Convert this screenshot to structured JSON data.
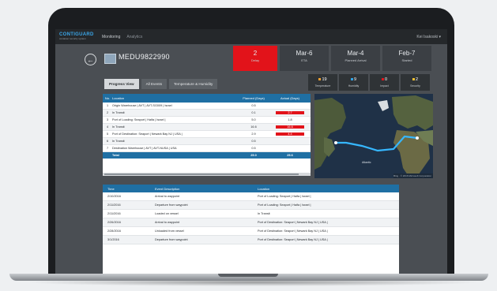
{
  "topbar": {
    "logo": "CONTIGUARD",
    "logo_sub": "container security system",
    "nav": [
      "Monitoring",
      "Analytics"
    ],
    "user": "Kei Isakoski ▾"
  },
  "header": {
    "container_id": "MEDU9822990",
    "stats": [
      {
        "big": "2",
        "small": "Delay",
        "style": "red"
      },
      {
        "big": "Mar-6",
        "small": "ETA",
        "style": "dark"
      },
      {
        "big": "Mar-4",
        "small": "Planned Arrival",
        "style": "dark"
      },
      {
        "big": "Feb-7",
        "small": "Started",
        "style": "dark"
      }
    ],
    "indicators": [
      {
        "value": "19",
        "label": "Temperature",
        "color": "#f0a030"
      },
      {
        "value": "9",
        "label": "Humidity",
        "color": "#2fa3e6"
      },
      {
        "value": "0",
        "label": "Impact",
        "color": "#e2131a"
      },
      {
        "value": "2",
        "label": "Security",
        "color": "#f0c030"
      }
    ]
  },
  "tabs": [
    "Progress View",
    "All Events",
    "Temperature & Humidity"
  ],
  "progress": {
    "headers": [
      "No.",
      "Location",
      "Planned (Days)",
      "Actual (Days)"
    ],
    "rows": [
      {
        "no": "1",
        "loc": "Origin Warehouse | AVT | AVT-SG009 | Israel",
        "plan": "0.5",
        "act": "",
        "act_red": false
      },
      {
        "no": "2",
        "loc": "In Transit",
        "plan": "0.1",
        "act": "2.7",
        "act_red": true
      },
      {
        "no": "3",
        "loc": "Port of Loading: Seaport | Haifa | Israel |",
        "plan": "5.0",
        "act": "1.8",
        "act_red": false
      },
      {
        "no": "4",
        "loc": "In Transit",
        "plan": "16.6",
        "act": "16.6",
        "act_red": true
      },
      {
        "no": "5",
        "loc": "Port of Destination: Seaport | Newark Bay NJ | USA |",
        "plan": "2.9",
        "act": "4.4",
        "act_red": true
      },
      {
        "no": "6",
        "loc": "In Transit",
        "plan": "0.5",
        "act": "",
        "act_red": false
      },
      {
        "no": "7",
        "loc": "Destination Warehouse | AVT | AVT-NUSA | USA",
        "plan": "0.5",
        "act": "",
        "act_red": false
      }
    ],
    "total": {
      "label": "Total",
      "plan": "25.0",
      "act": "25.6"
    }
  },
  "map": {
    "label": "Atlantic",
    "attribution": "Bing · © 2016 Microsoft Corporation"
  },
  "events": {
    "headers": [
      "Time",
      "Event Description",
      "Location"
    ],
    "rows": [
      {
        "time": "2/10/2016",
        "desc": "Arrival to waypoint",
        "loc": "Port of Loading: Seaport | Haifa | Israel |"
      },
      {
        "time": "2/11/2016",
        "desc": "Departure from waypoint",
        "loc": "Port of Loading: Seaport | Haifa | Israel |"
      },
      {
        "time": "2/11/2016",
        "desc": "Loaded on vessel",
        "loc": "In Transit"
      },
      {
        "time": "2/26/2016",
        "desc": "Arrival to waypoint",
        "loc": "Port of Destination: Seaport | Newark Bay NJ | USA |"
      },
      {
        "time": "2/28/2016",
        "desc": "Unloaded from vessel",
        "loc": "Port of Destination: Seaport | Newark Bay NJ | USA |"
      },
      {
        "time": "3/1/2016",
        "desc": "Departure from waypoint",
        "loc": "Port of Destination: Seaport | Newark Bay NJ | USA |"
      }
    ]
  }
}
